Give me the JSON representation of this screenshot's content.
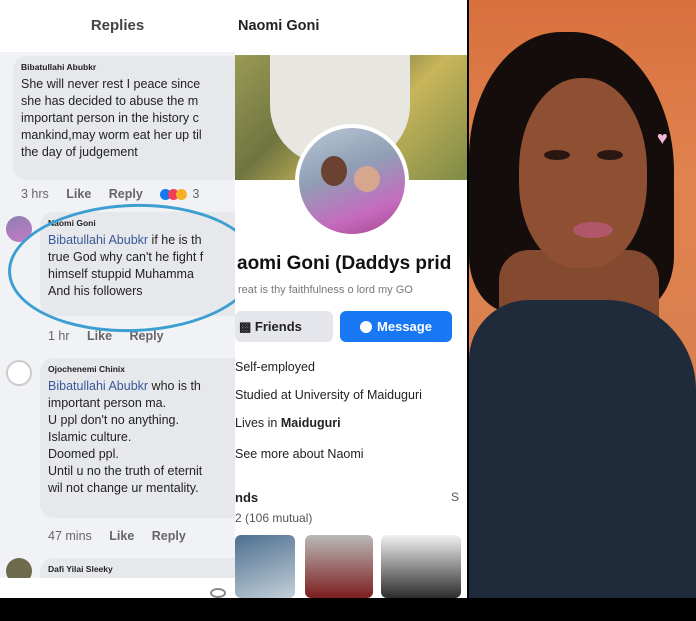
{
  "replies_panel": {
    "header": "Replies",
    "comments": [
      {
        "author": "Bibatullahi Abubkr",
        "lines": [
          "She will never rest I peace since",
          "she has decided to abuse the m",
          "important person in the history c",
          "mankind,may worm eat her up til",
          "the day of judgement"
        ],
        "time": "3 hrs",
        "like": "Like",
        "reply": "Reply",
        "reaction_count": "3"
      },
      {
        "author": "Naomi Goni",
        "tag": "Bibatullahi Abubkr",
        "first_rest": " if he is th",
        "lines": [
          "true God why can't he fight f",
          "himself  stuppid Muhamma",
          "And his followers"
        ],
        "time": "1 hr",
        "like": "Like",
        "reply": "Reply"
      },
      {
        "author": "Ojochenemi Chinix",
        "tag": "Bibatullahi Abubkr",
        "first_rest": " who is th",
        "lines": [
          "important person ma.",
          "U ppl don't no anything.",
          "Islamic culture.",
          "Doomed ppl.",
          "Until u no the truth of eternit",
          "wil not change ur mentality."
        ],
        "time": "47 mins",
        "like": "Like",
        "reply": "Reply"
      },
      {
        "author": "Dafi Yilai Sleeky"
      }
    ]
  },
  "profile_panel": {
    "title": "Naomi Goni",
    "name": "aomi Goni (Daddys prid",
    "bio": "reat is thy faithfulness o lord my GO",
    "friends_button": "Friends",
    "message_button": "Message",
    "info": {
      "work": "Self-employed",
      "study": "Studied at University of Maiduguri",
      "lives_prefix": "Lives in ",
      "lives_city": "Maiduguri",
      "see_more": "See more about Naomi"
    },
    "friends_heading": "nds",
    "friends_see": "S",
    "friends_mutual": "2 (106 mutual)"
  },
  "colors": {
    "accent": "#1877f2",
    "tag": "#385898",
    "highlight_circle": "#3d9fd1",
    "like_reaction": "#1877f2",
    "love_reaction": "#f33e58",
    "haha_reaction": "#f7b125"
  }
}
